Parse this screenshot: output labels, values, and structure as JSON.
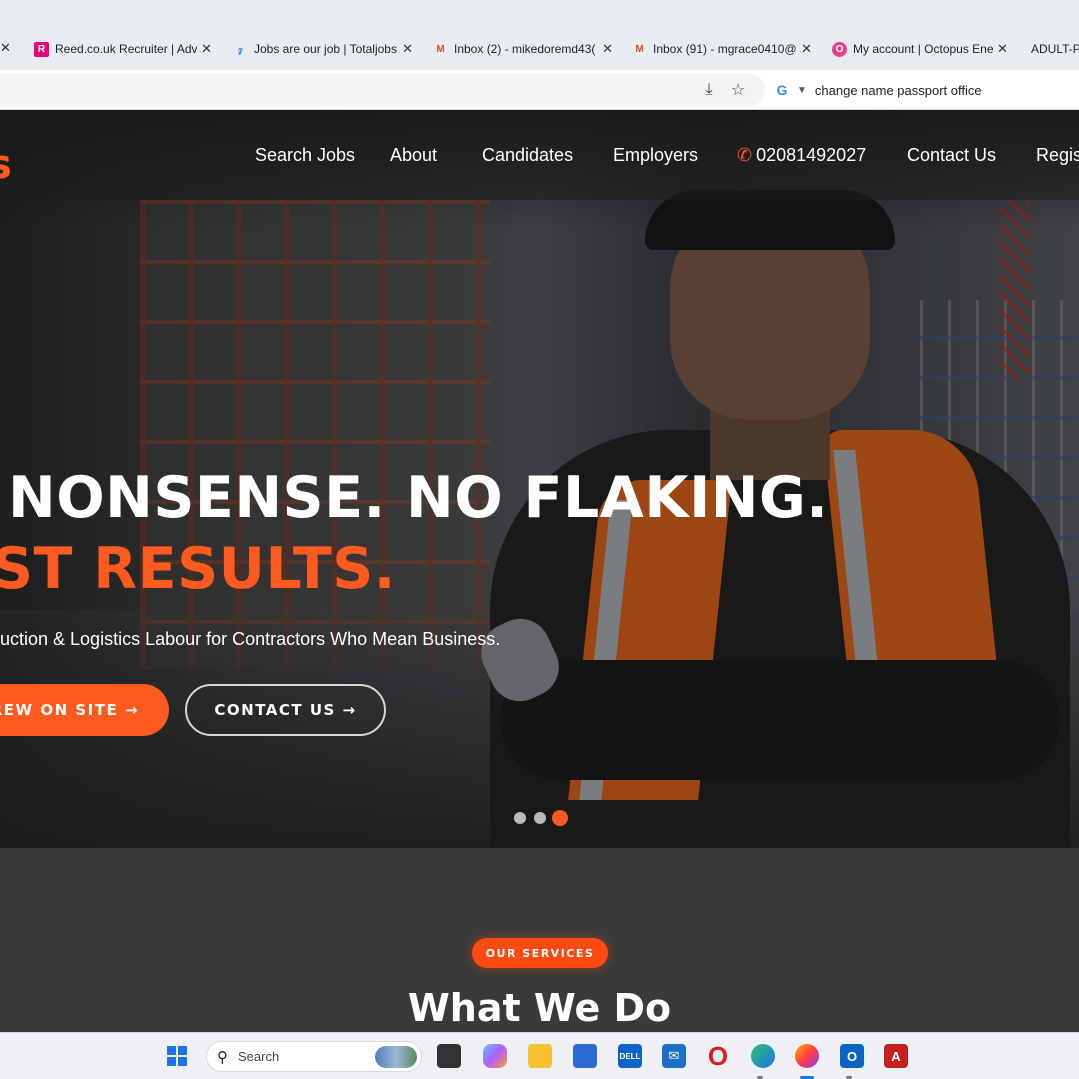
{
  "browser": {
    "tabs": [
      {
        "title": "Reed.co.uk Recruiter | Adve",
        "fav_color": "#e4007c",
        "fav_glyph": "R"
      },
      {
        "title": "Jobs are our job | Totaljobs",
        "fav_color": "#1e88e5",
        "fav_glyph": "T"
      },
      {
        "title": "Inbox (2) - mikedoremd43(",
        "fav_color": "#ea4335",
        "fav_glyph": "M"
      },
      {
        "title": "Inbox (91) - mgrace0410@",
        "fav_color": "#ea4335",
        "fav_glyph": "M"
      },
      {
        "title": "My account | Octopus Ener",
        "fav_color": "#e83e8c",
        "fav_glyph": "O"
      },
      {
        "title": "ADULT-PA",
        "fav_color": "",
        "fav_glyph": ""
      }
    ],
    "close_glyph": "✕",
    "search_query": "change name passport office",
    "search_engine": "G"
  },
  "site": {
    "brand": "s",
    "nav": {
      "search_jobs": "Search Jobs",
      "about": "About",
      "candidates": "Candidates",
      "employers": "Employers",
      "phone": "02081492027",
      "contact": "Contact Us",
      "register": "Regist"
    },
    "hero": {
      "headline_1": "NONSENSE. NO FLAKING.",
      "headline_2": "ST RESULTS.",
      "subtitle": "uction & Logistics Labour for Contractors Who Mean Business.",
      "primary_button": "REW ON SITE →",
      "secondary_button": "CONTACT US →",
      "slides_total": 3,
      "active_slide": 3
    },
    "services": {
      "badge": "OUR SERVICES",
      "title": "What We Do"
    }
  },
  "taskbar": {
    "search_placeholder": "Search"
  },
  "colors": {
    "accent": "#ff5a1f",
    "dark_section": "#3a3a3a"
  }
}
